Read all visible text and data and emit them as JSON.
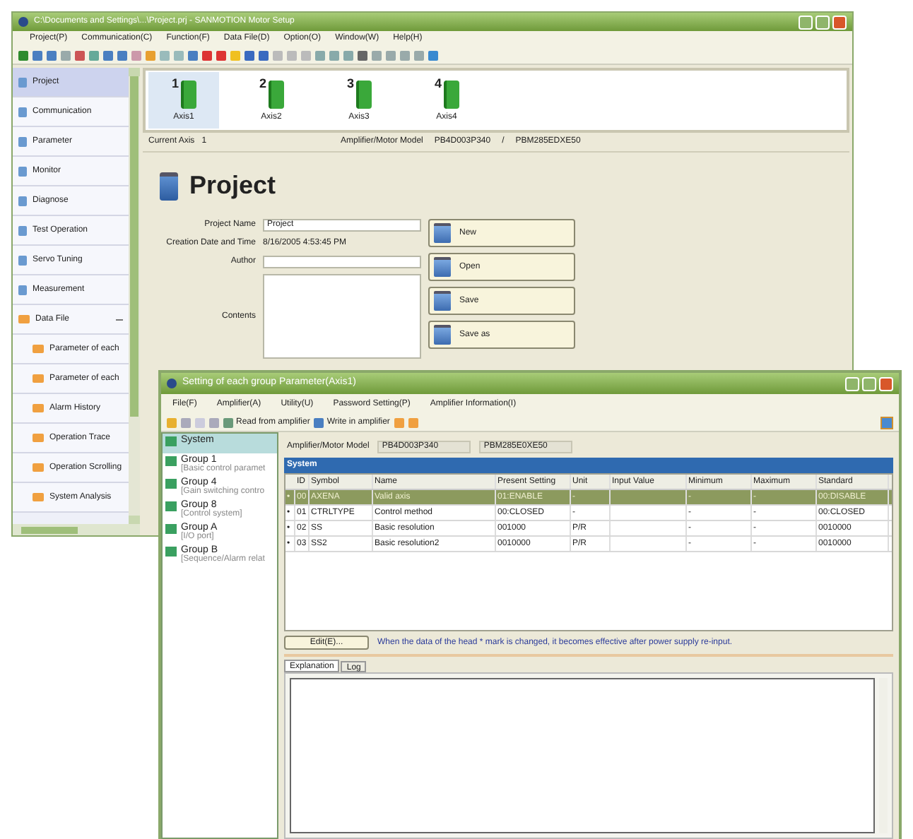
{
  "main_window": {
    "title": "C:\\Documents and Settings\\...\\Project.prj - SANMOTION Motor Setup",
    "menu": [
      "Project(P)",
      "Communication(C)",
      "Function(F)",
      "Data File(D)",
      "Option(O)",
      "Window(W)",
      "Help(H)"
    ],
    "sidebar": {
      "items": [
        {
          "label": "Project",
          "selected": true
        },
        {
          "label": "Communication",
          "selected": false
        },
        {
          "label": "Parameter",
          "selected": false
        },
        {
          "label": "Monitor",
          "selected": false
        },
        {
          "label": "Diagnose",
          "selected": false
        },
        {
          "label": "Test Operation",
          "selected": false
        },
        {
          "label": "Servo Tuning",
          "selected": false
        },
        {
          "label": "Measurement",
          "selected": false
        },
        {
          "label": "Data File",
          "selected": false,
          "expanded": true,
          "children": [
            {
              "label": "Parameter of each",
              "selected": false
            },
            {
              "label": "Parameter of each",
              "selected": false
            },
            {
              "label": "Alarm History",
              "selected": false
            },
            {
              "label": "Operation Trace",
              "selected": false
            },
            {
              "label": "Operation Scrolling",
              "selected": false
            },
            {
              "label": "System Analysis",
              "selected": false
            }
          ]
        }
      ]
    },
    "axes": [
      {
        "number": "1",
        "label": "Axis1",
        "selected": true
      },
      {
        "number": "2",
        "label": "Axis2",
        "selected": false
      },
      {
        "number": "3",
        "label": "Axis3",
        "selected": false
      },
      {
        "number": "4",
        "label": "Axis4",
        "selected": false
      }
    ],
    "info_bar": {
      "current_axis_label": "Current Axis",
      "current_axis": "1",
      "model_label": "Amplifier/Motor Model",
      "amplifier": "PB4D003P340",
      "separator": "/",
      "motor": "PBM285EDXE50"
    },
    "project": {
      "heading": "Project",
      "fields": [
        {
          "kind": "input",
          "label": "Project Name",
          "value": "Project"
        },
        {
          "kind": "text",
          "label": "Creation Date and Time",
          "value": "8/16/2005 4:53:45 PM"
        },
        {
          "kind": "input",
          "label": "Author"
        },
        {
          "kind": "textarea",
          "label": "Contents"
        }
      ],
      "buttons": [
        "New",
        "Open",
        "Save",
        "Save as"
      ]
    }
  },
  "param_window": {
    "title": "Setting of each group Parameter(Axis1)",
    "menu": [
      "File(F)",
      "Amplifier(A)",
      "Utility(U)",
      "Password Setting(P)",
      "Amplifier Information(I)"
    ],
    "toolbar": [
      "Read from amplifier",
      "Write in amplifier"
    ],
    "tree": [
      {
        "label": "System",
        "selected": true
      },
      {
        "label": "Group 1",
        "sublabel": "[Basic control paramet",
        "selected": false
      },
      {
        "label": "Group 4",
        "sublabel": "[Gain switching contro",
        "selected": false
      },
      {
        "label": "Group 8",
        "sublabel": "[Control system]",
        "selected": false
      },
      {
        "label": "Group A",
        "sublabel": "[I/O port]",
        "selected": false
      },
      {
        "label": "Group B",
        "sublabel": "[Sequence/Alarm relat",
        "selected": false
      }
    ],
    "model_label": "Amplifier/Motor Model",
    "amplifier": "PB4D003P340",
    "motor": "PBM285E0XE50",
    "section": "System",
    "columns": [
      "ID",
      "Symbol",
      "Name",
      "Present Setting",
      "Unit",
      "Input Value",
      "Minimum",
      "Maximum",
      "Standard"
    ],
    "rows": [
      {
        "mark": "•",
        "id": "00",
        "symbol": "AXENA",
        "name": "Valid axis",
        "present": "01:ENABLE",
        "unit": "-",
        "minimum": "-",
        "maximum": "-",
        "standard": "00:DISABLE",
        "selected": true
      },
      {
        "mark": "•",
        "id": "01",
        "symbol": "CTRLTYPE",
        "name": "Control method",
        "present": "00:CLOSED",
        "unit": "-",
        "minimum": "-",
        "maximum": "-",
        "standard": "00:CLOSED",
        "selected": false
      },
      {
        "mark": "•",
        "id": "02",
        "symbol": "SS",
        "name": "Basic resolution",
        "present": "001000",
        "unit": "P/R",
        "minimum": "-",
        "maximum": "-",
        "standard": "0010000",
        "selected": false
      },
      {
        "mark": "•",
        "id": "03",
        "symbol": "SS2",
        "name": "Basic resolution2",
        "present": "0010000",
        "unit": "P/R",
        "minimum": "-",
        "maximum": "-",
        "standard": "0010000",
        "selected": false
      }
    ],
    "edit_button": "Edit(E)...",
    "note": "When the data of the head * mark is changed, it becomes effective after power supply re-input.",
    "tabs": [
      {
        "label": "Explanation",
        "selected": true
      },
      {
        "label": "Log",
        "selected": false
      }
    ]
  }
}
